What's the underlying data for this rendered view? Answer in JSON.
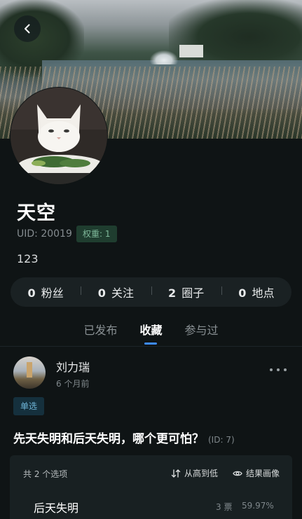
{
  "user": {
    "name": "天空",
    "uid": "UID: 20019",
    "weight": "权重: 1",
    "bio": "123"
  },
  "stats": [
    {
      "count": "0",
      "label": "粉丝"
    },
    {
      "count": "0",
      "label": "关注"
    },
    {
      "count": "2",
      "label": "圈子"
    },
    {
      "count": "0",
      "label": "地点"
    }
  ],
  "tabs": [
    {
      "label": "已发布",
      "active": false
    },
    {
      "label": "收藏",
      "active": true
    },
    {
      "label": "参与过",
      "active": false
    }
  ],
  "post": {
    "author": "刘力瑞",
    "time": "6 个月前",
    "type": "单选",
    "title": "先天失明和后天失明，哪个更可怕？",
    "id": "(ID: 7)",
    "option_count": "共 2 个选项",
    "sort_label": "从高到低",
    "portrait_label": "结果画像",
    "options": [
      {
        "label": "后天失明",
        "votes": "3 票",
        "percent": "59.97%"
      }
    ]
  },
  "colors": {
    "background": "#0f1415",
    "accent": "#3d8bff",
    "tag_green": "#7fb99a",
    "tag_blue": "#6fb5d8"
  },
  "icons": {
    "back": "chevron-left-icon",
    "more": "more-horizontal-icon",
    "sort": "sort-arrows-icon",
    "portrait": "eye-icon"
  }
}
